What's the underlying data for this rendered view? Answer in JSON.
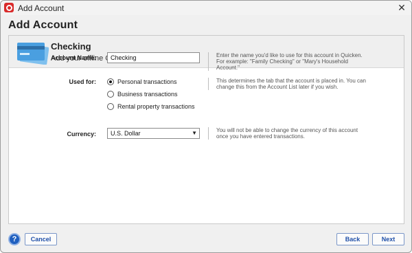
{
  "window": {
    "title": "Add Account",
    "close_glyph": "✕"
  },
  "heading": "Add Account",
  "banner": {
    "title": "Checking",
    "subtitle": "Add your offline Checking account",
    "icon": "credit-card-icon"
  },
  "form": {
    "account_name_label": "Account Name:",
    "account_name_value": "Checking",
    "used_for_label": "Used for:",
    "used_for_options": [
      {
        "label": "Personal transactions",
        "checked": true
      },
      {
        "label": "Business transactions",
        "checked": false
      },
      {
        "label": "Rental property transactions",
        "checked": false
      }
    ],
    "currency_label": "Currency:",
    "currency_value": "U.S. Dollar"
  },
  "help": {
    "account_name": "Enter the name you'd like to use for this account in Quicken. For example: \"Family Checking\" or \"Mary's Household Account.\"",
    "used_for": "This determines the tab that the account is placed in. You can change this from the Account List later if you wish.",
    "currency": "You will not be able to change the currency of this account once you have entered transactions."
  },
  "footer": {
    "help_glyph": "?",
    "cancel": "Cancel",
    "back": "Back",
    "next": "Next"
  },
  "colors": {
    "accent": "#1f4fa8",
    "app_icon": "#d92b2b",
    "card_icon": "#4a9fe0"
  }
}
